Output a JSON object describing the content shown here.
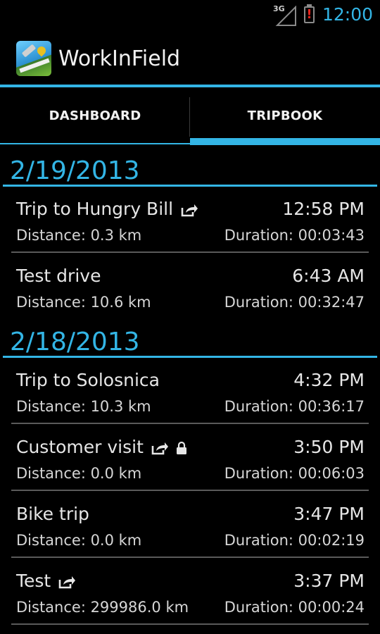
{
  "status_bar": {
    "network": "3G",
    "clock": "12:00",
    "battery_alert": "!"
  },
  "action_bar": {
    "title": "WorkInField",
    "icon": "app-logo-icon"
  },
  "tabs": [
    {
      "label": "DASHBOARD",
      "selected": false
    },
    {
      "label": "TRIPBOOK",
      "selected": true
    }
  ],
  "days": [
    {
      "date": "2/19/2013",
      "trips": [
        {
          "name": "Trip to Hungry Bill",
          "time": "12:58 PM",
          "distance": "Distance: 0.3 km",
          "duration": "Duration: 00:03:43",
          "shared": true,
          "locked": false
        },
        {
          "name": "Test drive",
          "time": "6:43 AM",
          "distance": "Distance: 10.6 km",
          "duration": "Duration: 00:32:47",
          "shared": false,
          "locked": false
        }
      ]
    },
    {
      "date": "2/18/2013",
      "trips": [
        {
          "name": "Trip to Solosnica",
          "time": "4:32 PM",
          "distance": "Distance: 10.3 km",
          "duration": "Duration: 00:36:17",
          "shared": false,
          "locked": false
        },
        {
          "name": "Customer visit",
          "time": "3:50 PM",
          "distance": "Distance: 0.0 km",
          "duration": "Duration: 00:06:03",
          "shared": true,
          "locked": true
        },
        {
          "name": "Bike trip",
          "time": "3:47 PM",
          "distance": "Distance: 0.0 km",
          "duration": "Duration: 00:02:19",
          "shared": false,
          "locked": false
        },
        {
          "name": "Test",
          "time": "3:37 PM",
          "distance": "Distance: 299986.0 km",
          "duration": "Duration: 00:00:24",
          "shared": true,
          "locked": false
        }
      ]
    }
  ],
  "colors": {
    "accent": "#33b5e5",
    "background": "#000000",
    "battery_alert": "#e8231c"
  }
}
